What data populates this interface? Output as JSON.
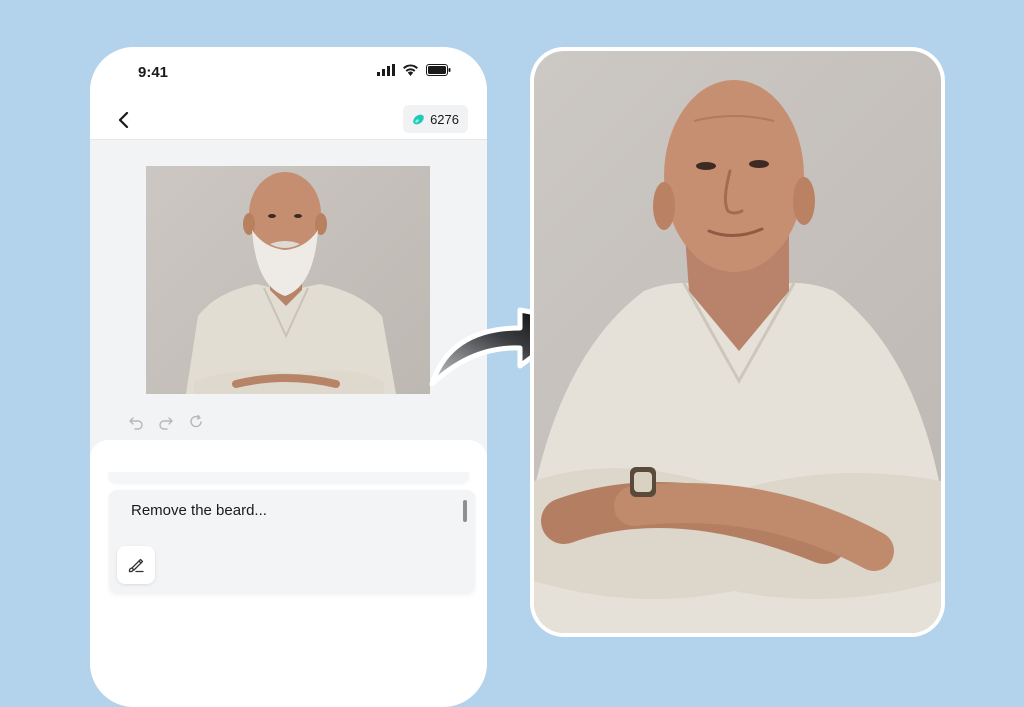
{
  "status_bar": {
    "time": "9:41",
    "icons": [
      "signal-icon",
      "wifi-icon",
      "battery-icon"
    ]
  },
  "nav": {
    "back_icon": "chevron-left-icon",
    "credits": "6276",
    "credits_icon": "gem-icon"
  },
  "editor": {
    "history_icons": [
      "undo-icon",
      "redo-icon",
      "refresh-icon"
    ],
    "prompt_text": "Remove the beard...",
    "brush_icon": "brush-icon"
  },
  "colors": {
    "background": "#b3d3ec",
    "phone_bg": "#f2f3f5",
    "credits_gem": "#22c9b7"
  }
}
